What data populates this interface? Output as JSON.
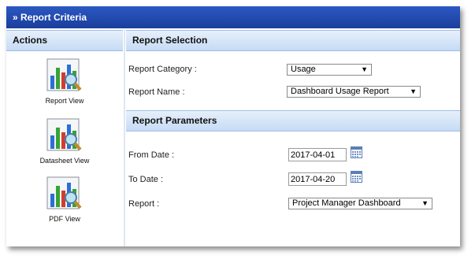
{
  "title": "» Report Criteria",
  "actions": {
    "header": "Actions",
    "items": [
      {
        "label": "Report View",
        "icon": "report-chart-icon"
      },
      {
        "label": "Datasheet View",
        "icon": "datasheet-chart-icon"
      },
      {
        "label": "PDF View",
        "icon": "pdf-chart-icon"
      }
    ]
  },
  "selection": {
    "header": "Report Selection",
    "category_label": "Report Category :",
    "category_value": "Usage",
    "name_label": "Report Name :",
    "name_value": "Dashboard Usage Report"
  },
  "parameters": {
    "header": "Report Parameters",
    "from_label": "From Date :",
    "from_value": "2017-04-01",
    "to_label": "To Date :",
    "to_value": "2017-04-20",
    "report_label": "Report :",
    "report_value": "Project Manager Dashboard"
  },
  "colors": {
    "title_bar": "#1f47a8",
    "section_header": "#d4e4f7"
  }
}
